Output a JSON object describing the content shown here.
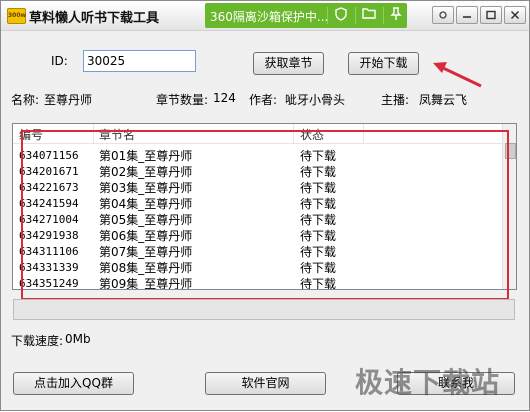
{
  "window": {
    "title": "草料懒人听书下载工具",
    "app_icon_text": "300w"
  },
  "sandbox_bar": {
    "text": "360隔离沙箱保护中...",
    "color": "#69b82b"
  },
  "form": {
    "id_label": "ID:",
    "id_value": "30025",
    "fetch_button": "获取章节",
    "start_button": "开始下载"
  },
  "info": {
    "name_label": "名称:",
    "name_value": "至尊丹师",
    "count_label": "章节数量:",
    "count_value": "124",
    "author_label": "作者:",
    "author_value": "呲牙小骨头",
    "host_label": "主播:",
    "host_value": "凤舞云飞"
  },
  "table": {
    "columns": [
      "编号",
      "章节名",
      "状态"
    ],
    "rows": [
      {
        "id": "634071156",
        "name": "第01集_至尊丹师",
        "status": "待下载"
      },
      {
        "id": "634201671",
        "name": "第02集_至尊丹师",
        "status": "待下载"
      },
      {
        "id": "634221673",
        "name": "第03集_至尊丹师",
        "status": "待下载"
      },
      {
        "id": "634241594",
        "name": "第04集_至尊丹师",
        "status": "待下载"
      },
      {
        "id": "634271004",
        "name": "第05集_至尊丹师",
        "status": "待下载"
      },
      {
        "id": "634291938",
        "name": "第06集_至尊丹师",
        "status": "待下载"
      },
      {
        "id": "634311106",
        "name": "第07集_至尊丹师",
        "status": "待下载"
      },
      {
        "id": "634331339",
        "name": "第08集_至尊丹师",
        "status": "待下载"
      },
      {
        "id": "634351249",
        "name": "第09集_至尊丹师",
        "status": "待下载"
      }
    ]
  },
  "status": {
    "speed_label": "下载速度:",
    "speed_value": "0Mb"
  },
  "footer": {
    "qq_button": "点击加入QQ群",
    "website_button": "软件官网",
    "contact_button": "联系我"
  },
  "watermark": "极速下载站",
  "annotation_color": "#d82a3a"
}
